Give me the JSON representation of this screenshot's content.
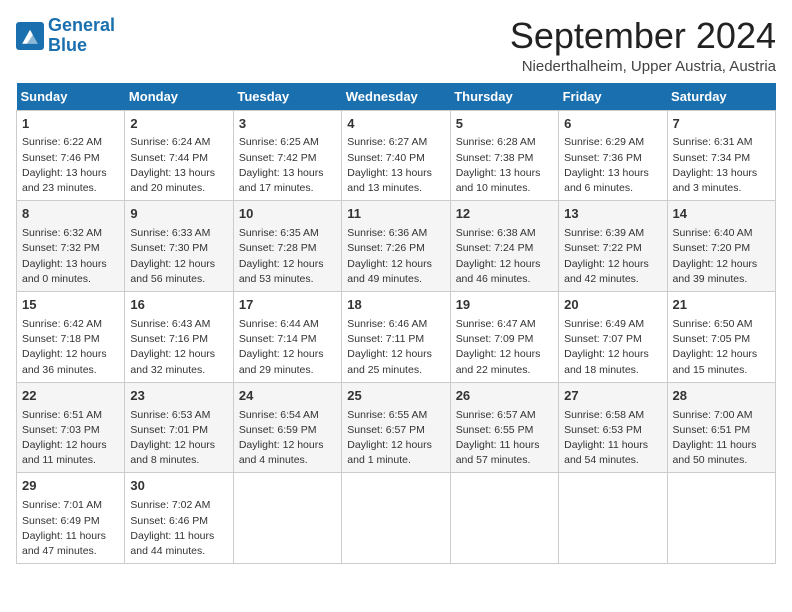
{
  "header": {
    "logo_line1": "General",
    "logo_line2": "Blue",
    "month": "September 2024",
    "location": "Niederthalheim, Upper Austria, Austria"
  },
  "weekdays": [
    "Sunday",
    "Monday",
    "Tuesday",
    "Wednesday",
    "Thursday",
    "Friday",
    "Saturday"
  ],
  "weeks": [
    [
      {
        "day": "1",
        "lines": [
          "Sunrise: 6:22 AM",
          "Sunset: 7:46 PM",
          "Daylight: 13 hours",
          "and 23 minutes."
        ]
      },
      {
        "day": "2",
        "lines": [
          "Sunrise: 6:24 AM",
          "Sunset: 7:44 PM",
          "Daylight: 13 hours",
          "and 20 minutes."
        ]
      },
      {
        "day": "3",
        "lines": [
          "Sunrise: 6:25 AM",
          "Sunset: 7:42 PM",
          "Daylight: 13 hours",
          "and 17 minutes."
        ]
      },
      {
        "day": "4",
        "lines": [
          "Sunrise: 6:27 AM",
          "Sunset: 7:40 PM",
          "Daylight: 13 hours",
          "and 13 minutes."
        ]
      },
      {
        "day": "5",
        "lines": [
          "Sunrise: 6:28 AM",
          "Sunset: 7:38 PM",
          "Daylight: 13 hours",
          "and 10 minutes."
        ]
      },
      {
        "day": "6",
        "lines": [
          "Sunrise: 6:29 AM",
          "Sunset: 7:36 PM",
          "Daylight: 13 hours",
          "and 6 minutes."
        ]
      },
      {
        "day": "7",
        "lines": [
          "Sunrise: 6:31 AM",
          "Sunset: 7:34 PM",
          "Daylight: 13 hours",
          "and 3 minutes."
        ]
      }
    ],
    [
      {
        "day": "8",
        "lines": [
          "Sunrise: 6:32 AM",
          "Sunset: 7:32 PM",
          "Daylight: 13 hours",
          "and 0 minutes."
        ]
      },
      {
        "day": "9",
        "lines": [
          "Sunrise: 6:33 AM",
          "Sunset: 7:30 PM",
          "Daylight: 12 hours",
          "and 56 minutes."
        ]
      },
      {
        "day": "10",
        "lines": [
          "Sunrise: 6:35 AM",
          "Sunset: 7:28 PM",
          "Daylight: 12 hours",
          "and 53 minutes."
        ]
      },
      {
        "day": "11",
        "lines": [
          "Sunrise: 6:36 AM",
          "Sunset: 7:26 PM",
          "Daylight: 12 hours",
          "and 49 minutes."
        ]
      },
      {
        "day": "12",
        "lines": [
          "Sunrise: 6:38 AM",
          "Sunset: 7:24 PM",
          "Daylight: 12 hours",
          "and 46 minutes."
        ]
      },
      {
        "day": "13",
        "lines": [
          "Sunrise: 6:39 AM",
          "Sunset: 7:22 PM",
          "Daylight: 12 hours",
          "and 42 minutes."
        ]
      },
      {
        "day": "14",
        "lines": [
          "Sunrise: 6:40 AM",
          "Sunset: 7:20 PM",
          "Daylight: 12 hours",
          "and 39 minutes."
        ]
      }
    ],
    [
      {
        "day": "15",
        "lines": [
          "Sunrise: 6:42 AM",
          "Sunset: 7:18 PM",
          "Daylight: 12 hours",
          "and 36 minutes."
        ]
      },
      {
        "day": "16",
        "lines": [
          "Sunrise: 6:43 AM",
          "Sunset: 7:16 PM",
          "Daylight: 12 hours",
          "and 32 minutes."
        ]
      },
      {
        "day": "17",
        "lines": [
          "Sunrise: 6:44 AM",
          "Sunset: 7:14 PM",
          "Daylight: 12 hours",
          "and 29 minutes."
        ]
      },
      {
        "day": "18",
        "lines": [
          "Sunrise: 6:46 AM",
          "Sunset: 7:11 PM",
          "Daylight: 12 hours",
          "and 25 minutes."
        ]
      },
      {
        "day": "19",
        "lines": [
          "Sunrise: 6:47 AM",
          "Sunset: 7:09 PM",
          "Daylight: 12 hours",
          "and 22 minutes."
        ]
      },
      {
        "day": "20",
        "lines": [
          "Sunrise: 6:49 AM",
          "Sunset: 7:07 PM",
          "Daylight: 12 hours",
          "and 18 minutes."
        ]
      },
      {
        "day": "21",
        "lines": [
          "Sunrise: 6:50 AM",
          "Sunset: 7:05 PM",
          "Daylight: 12 hours",
          "and 15 minutes."
        ]
      }
    ],
    [
      {
        "day": "22",
        "lines": [
          "Sunrise: 6:51 AM",
          "Sunset: 7:03 PM",
          "Daylight: 12 hours",
          "and 11 minutes."
        ]
      },
      {
        "day": "23",
        "lines": [
          "Sunrise: 6:53 AM",
          "Sunset: 7:01 PM",
          "Daylight: 12 hours",
          "and 8 minutes."
        ]
      },
      {
        "day": "24",
        "lines": [
          "Sunrise: 6:54 AM",
          "Sunset: 6:59 PM",
          "Daylight: 12 hours",
          "and 4 minutes."
        ]
      },
      {
        "day": "25",
        "lines": [
          "Sunrise: 6:55 AM",
          "Sunset: 6:57 PM",
          "Daylight: 12 hours",
          "and 1 minute."
        ]
      },
      {
        "day": "26",
        "lines": [
          "Sunrise: 6:57 AM",
          "Sunset: 6:55 PM",
          "Daylight: 11 hours",
          "and 57 minutes."
        ]
      },
      {
        "day": "27",
        "lines": [
          "Sunrise: 6:58 AM",
          "Sunset: 6:53 PM",
          "Daylight: 11 hours",
          "and 54 minutes."
        ]
      },
      {
        "day": "28",
        "lines": [
          "Sunrise: 7:00 AM",
          "Sunset: 6:51 PM",
          "Daylight: 11 hours",
          "and 50 minutes."
        ]
      }
    ],
    [
      {
        "day": "29",
        "lines": [
          "Sunrise: 7:01 AM",
          "Sunset: 6:49 PM",
          "Daylight: 11 hours",
          "and 47 minutes."
        ]
      },
      {
        "day": "30",
        "lines": [
          "Sunrise: 7:02 AM",
          "Sunset: 6:46 PM",
          "Daylight: 11 hours",
          "and 44 minutes."
        ]
      },
      {
        "day": "",
        "lines": []
      },
      {
        "day": "",
        "lines": []
      },
      {
        "day": "",
        "lines": []
      },
      {
        "day": "",
        "lines": []
      },
      {
        "day": "",
        "lines": []
      }
    ]
  ]
}
